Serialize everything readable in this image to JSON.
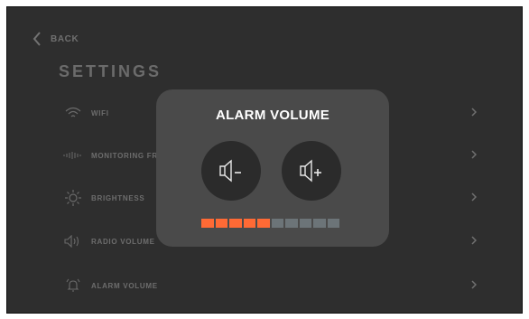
{
  "settings": {
    "back_label": "BACK",
    "title": "SETTINGS",
    "items": [
      {
        "label": "WIFI",
        "icon": "wifi-icon",
        "slug": "wifi"
      },
      {
        "label": "MONITORING FR",
        "icon": "signal-icon",
        "slug": "monitoring"
      },
      {
        "label": "BRIGHTNESS",
        "icon": "sun-icon",
        "slug": "brightness"
      },
      {
        "label": "RADIO VOLUME",
        "icon": "speaker-icon",
        "slug": "radio-volume"
      },
      {
        "label": "ALARM VOLUME",
        "icon": "bell-icon",
        "slug": "alarm-volume"
      }
    ]
  },
  "dialog": {
    "title": "ALARM VOLUME",
    "volume_down_icon": "volume-down-icon",
    "volume_up_icon": "volume-up-icon",
    "level": 5,
    "max_level": 10
  },
  "colors": {
    "background": "#2e2e2e",
    "dialog": "#4a4a4a",
    "accent": "#ff6a35",
    "inactive_segment": "#6c7478"
  }
}
